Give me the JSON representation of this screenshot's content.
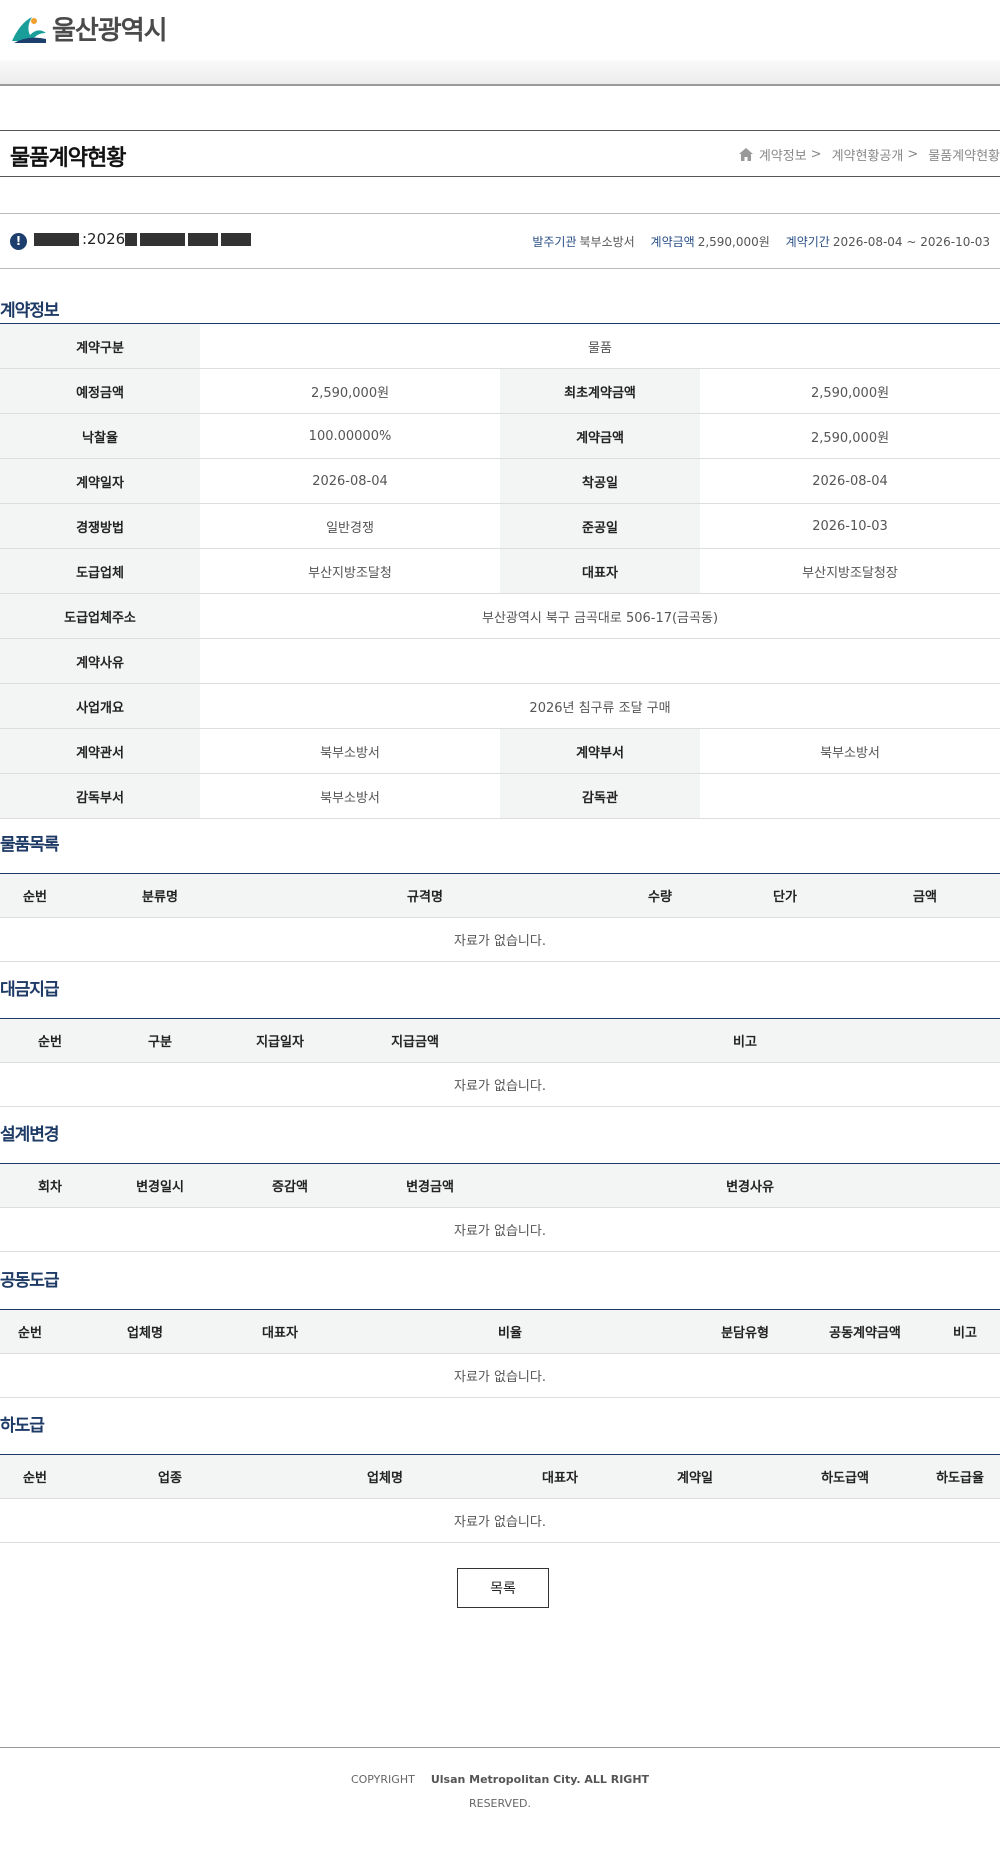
{
  "header": {
    "logo_text": "울산광역시"
  },
  "title": {
    "page_title": "물품계약현황",
    "breadcrumb": [
      "계약정보",
      "계약현황공개",
      "물품계약현황"
    ],
    "breadcrumb_sep": ">"
  },
  "summary": {
    "title_prefix": ":2026",
    "meta": [
      {
        "label": "발주기관",
        "value": "북부소방서"
      },
      {
        "label": "계약금액",
        "value": "2,590,000원"
      },
      {
        "label": "계약기간",
        "value": "2026-08-04 ~ 2026-10-03"
      }
    ]
  },
  "contract_info": {
    "section_title": "계약정보",
    "rows": [
      [
        {
          "label": "계약구분",
          "value": "물품"
        }
      ],
      [
        {
          "label": "예정금액",
          "value": "2,590,000원"
        },
        {
          "label": "최초계약금액",
          "value": "2,590,000원"
        }
      ],
      [
        {
          "label": "낙찰율",
          "value": "100.00000%"
        },
        {
          "label": "계약금액",
          "value": "2,590,000원"
        }
      ],
      [
        {
          "label": "계약일자",
          "value": "2026-08-04"
        },
        {
          "label": "착공일",
          "value": "2026-08-04"
        }
      ],
      [
        {
          "label": "경쟁방법",
          "value": "일반경쟁"
        },
        {
          "label": "준공일",
          "value": "2026-10-03"
        }
      ],
      [
        {
          "label": "도급업체",
          "value": "부산지방조달청"
        },
        {
          "label": "대표자",
          "value": "부산지방조달청장"
        }
      ],
      [
        {
          "label": "도급업체주소",
          "value": "부산광역시 북구 금곡대로 506-17(금곡동)"
        }
      ],
      [
        {
          "label": "계약사유",
          "value": ""
        }
      ],
      [
        {
          "label": "사업개요",
          "value": "2026년 침구류 조달 구매"
        }
      ],
      [
        {
          "label": "계약관서",
          "value": "북부소방서"
        },
        {
          "label": "계약부서",
          "value": "북부소방서"
        }
      ],
      [
        {
          "label": "감독부서",
          "value": "북부소방서"
        },
        {
          "label": "감독관",
          "value": ""
        }
      ]
    ]
  },
  "lists": [
    {
      "title": "물품목록",
      "columns": [
        "순번",
        "분류명",
        "규격명",
        "수량",
        "단가",
        "금액"
      ],
      "empty": "자료가 없습니다."
    },
    {
      "title": "대금지급",
      "columns": [
        "순번",
        "구분",
        "지급일자",
        "지급금액",
        "비고"
      ],
      "empty": "자료가 없습니다."
    },
    {
      "title": "설계변경",
      "columns": [
        "회차",
        "변경일시",
        "증감액",
        "변경금액",
        "변경사유"
      ],
      "empty": "자료가 없습니다."
    },
    {
      "title": "공동도급",
      "columns": [
        "순번",
        "업체명",
        "대표자",
        "비율",
        "분담유형",
        "공동계약금액",
        "비고"
      ],
      "empty": "자료가 없습니다."
    },
    {
      "title": "하도급",
      "columns": [
        "순번",
        "업종",
        "업체명",
        "대표자",
        "계약일",
        "하도급액",
        "하도급율"
      ],
      "empty": "자료가 없습니다."
    }
  ],
  "buttons": {
    "list_label": "목록"
  },
  "footer": {
    "copyright": "COPYRIGHT",
    "org": "Ulsan Metropolitan City. ALL RIGHT",
    "reserved": "RESERVED."
  }
}
